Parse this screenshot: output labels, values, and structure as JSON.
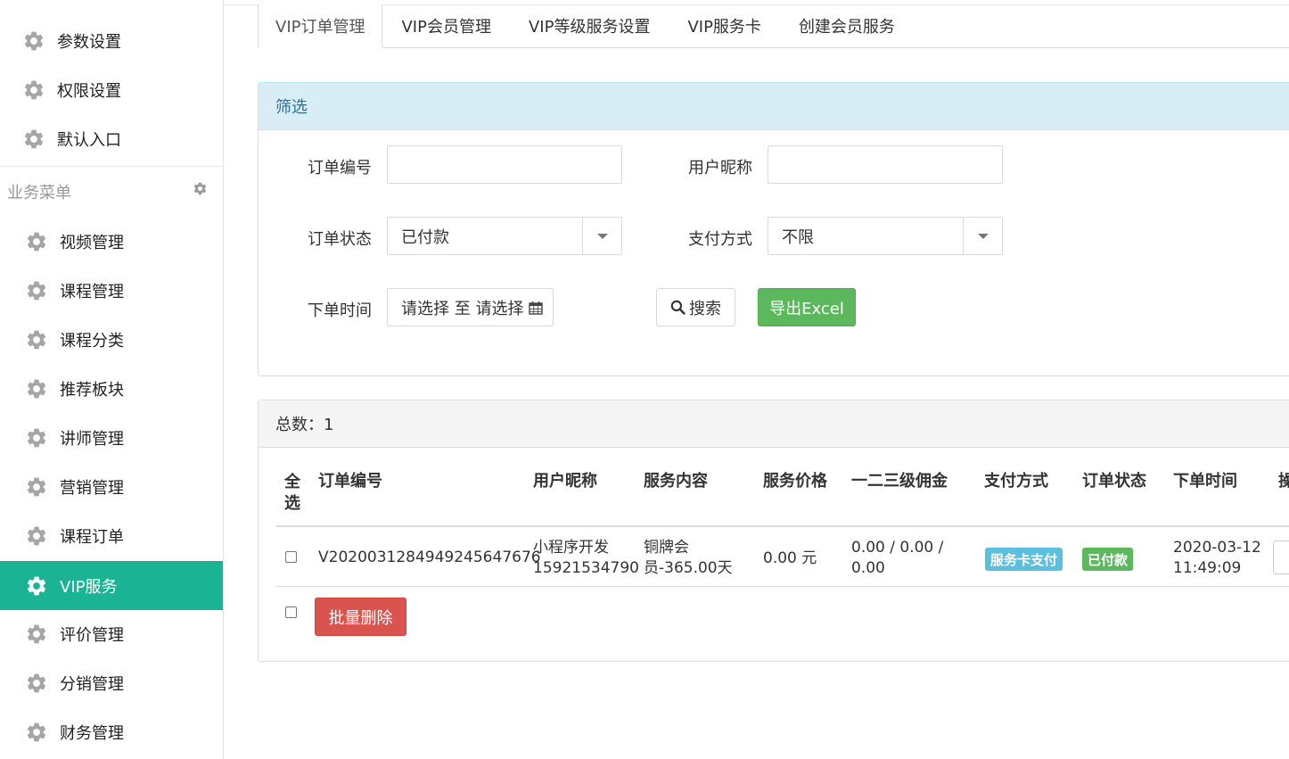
{
  "sidebar": {
    "top_items": [
      {
        "label": "参数设置"
      },
      {
        "label": "权限设置"
      },
      {
        "label": "默认入口"
      }
    ],
    "section_label": "业务菜单",
    "business_items": [
      {
        "label": "视频管理"
      },
      {
        "label": "课程管理"
      },
      {
        "label": "课程分类"
      },
      {
        "label": "推荐板块"
      },
      {
        "label": "讲师管理"
      },
      {
        "label": "营销管理"
      },
      {
        "label": "课程订单"
      },
      {
        "label": "VIP服务",
        "active": true
      },
      {
        "label": "评价管理"
      },
      {
        "label": "分销管理"
      },
      {
        "label": "财务管理"
      }
    ],
    "active_color": "#1ab394"
  },
  "tabs": [
    {
      "label": "VIP订单管理",
      "active": true
    },
    {
      "label": "VIP会员管理"
    },
    {
      "label": "VIP等级服务设置"
    },
    {
      "label": "VIP服务卡"
    },
    {
      "label": "创建会员服务"
    }
  ],
  "filter": {
    "title": "筛选",
    "order_no_label": "订单编号",
    "order_no_value": "",
    "nickname_label": "用户昵称",
    "nickname_value": "",
    "status_label": "订单状态",
    "status_value": "已付款",
    "pay_label": "支付方式",
    "pay_value": "不限",
    "time_label": "下单时间",
    "time_value": "请选择 至 请选择",
    "search_label": "搜索",
    "export_label": "导出Excel"
  },
  "list": {
    "total_text": "总数：1",
    "columns": {
      "select_all": "全选",
      "order_no": "订单编号",
      "nickname": "用户昵称",
      "content": "服务内容",
      "price": "服务价格",
      "commission": "一二三级佣金",
      "pay_method": "支付方式",
      "status": "订单状态",
      "time": "下单时间",
      "ops": "操"
    },
    "rows": [
      {
        "order_no": "V2020031284949245647676",
        "nickname_line1": "小程序开发",
        "nickname_line2": "15921534790",
        "content_line1": "铜牌会",
        "content_line2": "员-365.00天",
        "price": "0.00 元",
        "commission_line1": "0.00 / 0.00 /",
        "commission_line2": "0.00",
        "pay_method": "服务卡支付",
        "status": "已付款",
        "time_line1": "2020-03-12",
        "time_line2": "11:49:09"
      }
    ],
    "batch_delete_label": "批量删除"
  }
}
